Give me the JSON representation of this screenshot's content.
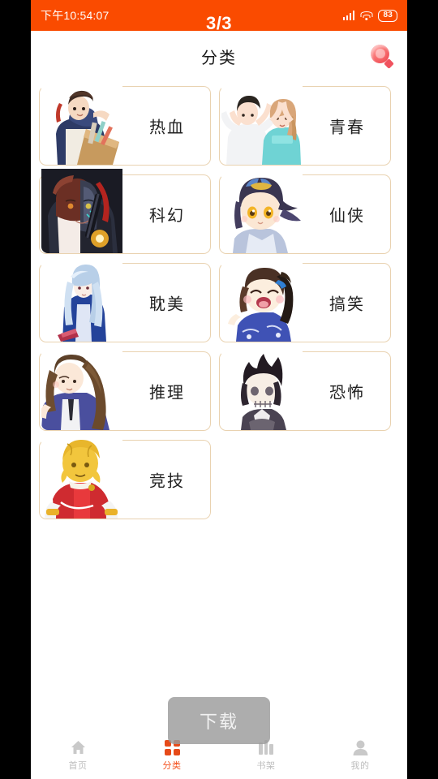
{
  "status_bar": {
    "time": "下午10:54:07",
    "battery": "83",
    "signal_icon": "signal-bars-icon",
    "wifi_icon": "wifi-icon"
  },
  "page_indicator": "3/3",
  "header": {
    "title": "分类",
    "search_icon": "search-icon"
  },
  "categories": [
    {
      "label": "热血",
      "thumb": "action-hero-with-parcel"
    },
    {
      "label": "青春",
      "thumb": "couple-heart-pose"
    },
    {
      "label": "科幻",
      "thumb": "cyborg-half-face"
    },
    {
      "label": "仙侠",
      "thumb": "chibi-immortal-boy"
    },
    {
      "label": "耽美",
      "thumb": "long-blue-hair-figure"
    },
    {
      "label": "搞笑",
      "thumb": "chibi-girl-laughing"
    },
    {
      "label": "推理",
      "thumb": "schoolgirl-detective"
    },
    {
      "label": "恐怖",
      "thumb": "dark-spiky-hair-ghost"
    },
    {
      "label": "竞技",
      "thumb": "helmeted-racer"
    }
  ],
  "toast": {
    "message": "下载"
  },
  "bottom_nav": {
    "items": [
      {
        "label": "首页",
        "icon": "home-icon",
        "active": false
      },
      {
        "label": "分类",
        "icon": "grid-icon",
        "active": true
      },
      {
        "label": "书架",
        "icon": "shelf-icon",
        "active": false
      },
      {
        "label": "我的",
        "icon": "person-icon",
        "active": false
      }
    ]
  },
  "colors": {
    "status_bar": "#FA4B00",
    "accent": "#E64A19",
    "card_border": "#E9D2B0",
    "inactive_nav": "#BDBDBD"
  }
}
